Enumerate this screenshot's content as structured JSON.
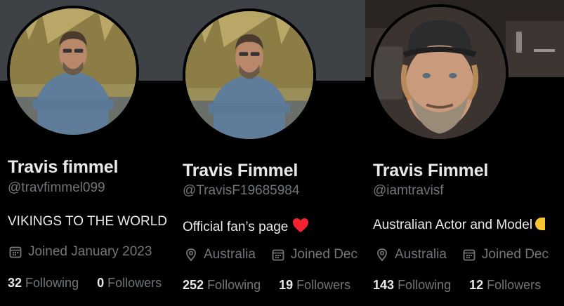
{
  "profiles": [
    {
      "display_name": "Travis fimmel",
      "handle": "@travfimmel099",
      "bio": "VIKINGS TO THE WORLD",
      "location": "",
      "joined": "Joined January 2023",
      "following_count": "32",
      "following_label": "Following",
      "followers_count": "0",
      "followers_label": "Followers",
      "banner_color": "#3e4145"
    },
    {
      "display_name": "Travis Fimmel",
      "handle": "@TravisF19685984",
      "bio": "Official fan’s page",
      "bio_emoji": "heart-icon",
      "location": "Australia",
      "joined": "Joined Dec",
      "following_count": "252",
      "following_label": "Following",
      "followers_count": "19",
      "followers_label": "Followers",
      "banner_color": "#3e4145"
    },
    {
      "display_name": "Travis Fimmel",
      "handle": "@iamtravisf",
      "bio": "Australian Actor and Model",
      "location": "Australia",
      "joined": "Joined Dec",
      "following_count": "143",
      "following_label": "Following",
      "followers_count": "12",
      "followers_label": "Followers",
      "banner_color": "#2a2523"
    }
  ],
  "colors": {
    "background": "#000000",
    "text": "#e7e9ea",
    "muted": "#71767b",
    "heart": "#f4212e"
  }
}
